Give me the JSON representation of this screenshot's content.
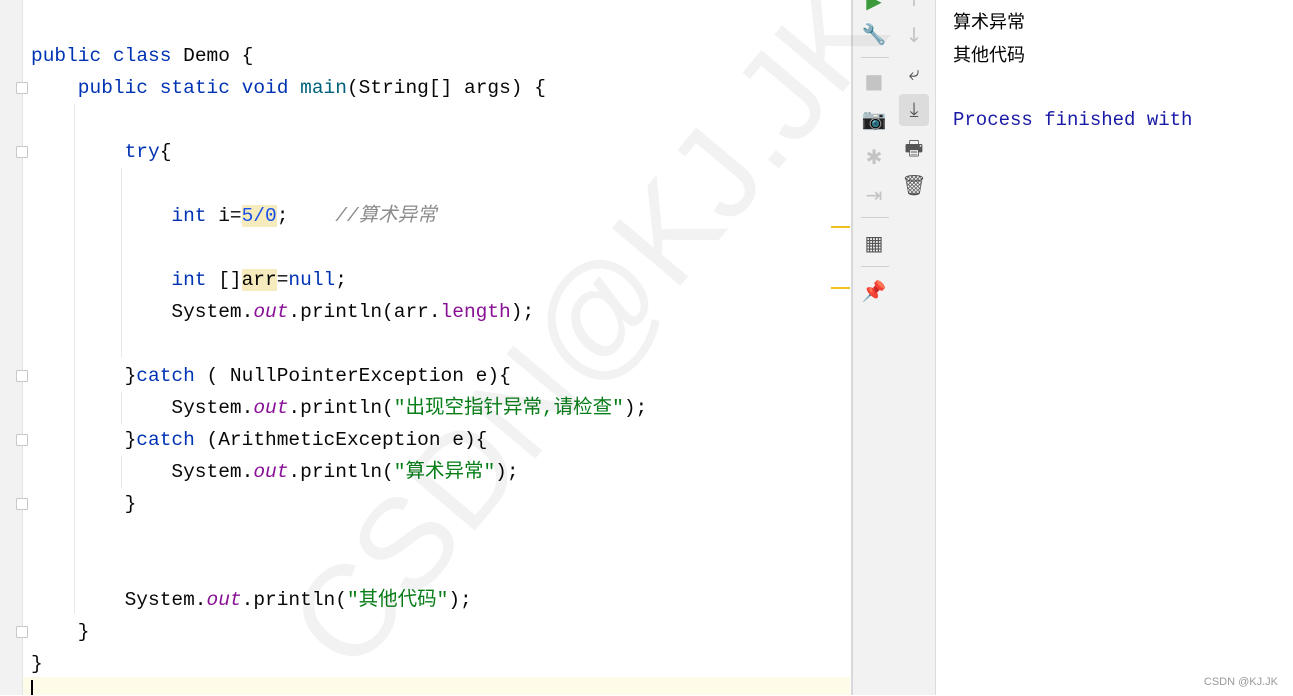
{
  "editor": {
    "lines": [
      {
        "row": 1,
        "indent": 0,
        "tokens": [
          [
            "public ",
            "kw"
          ],
          [
            "class ",
            "kw"
          ],
          [
            "Demo {",
            ""
          ]
        ]
      },
      {
        "row": 2,
        "indent": 1,
        "tokens": [
          [
            "public ",
            "kw"
          ],
          [
            "static ",
            "kw"
          ],
          [
            "void ",
            "kw"
          ],
          [
            "main",
            "fn"
          ],
          [
            "(String[] args) {",
            ""
          ]
        ]
      },
      {
        "row": 4,
        "indent": 2,
        "tokens": [
          [
            "try",
            "kw"
          ],
          [
            "{",
            ""
          ]
        ]
      },
      {
        "row": 6,
        "indent": 3,
        "tokens": [
          [
            "int ",
            "kw"
          ],
          [
            "i=",
            ""
          ],
          [
            "5/0",
            "num hl"
          ],
          [
            ";    ",
            ""
          ],
          [
            "//算术异常",
            "cm"
          ]
        ]
      },
      {
        "row": 8,
        "indent": 3,
        "tokens": [
          [
            "int ",
            "kw"
          ],
          [
            "[]",
            ""
          ],
          [
            "arr",
            "var hl"
          ],
          [
            "=",
            ""
          ],
          [
            "null",
            "kw"
          ],
          [
            ";",
            ""
          ]
        ]
      },
      {
        "row": 9,
        "indent": 3,
        "tokens": [
          [
            "System.",
            ""
          ],
          [
            "out",
            "fld"
          ],
          [
            ".println(arr.",
            ""
          ],
          [
            "length",
            "prop"
          ],
          [
            ");",
            ""
          ]
        ]
      },
      {
        "row": 11,
        "indent": 2,
        "tokens": [
          [
            "}",
            ""
          ],
          [
            "catch ",
            "kw"
          ],
          [
            "( NullPointerException e){",
            ""
          ]
        ]
      },
      {
        "row": 12,
        "indent": 3,
        "tokens": [
          [
            "System.",
            ""
          ],
          [
            "out",
            "fld"
          ],
          [
            ".println(",
            ""
          ],
          [
            "\"出现空指针异常,请检查\"",
            "st"
          ],
          [
            ");",
            ""
          ]
        ]
      },
      {
        "row": 13,
        "indent": 2,
        "tokens": [
          [
            "}",
            ""
          ],
          [
            "catch ",
            "kw"
          ],
          [
            "(ArithmeticException e){",
            ""
          ]
        ]
      },
      {
        "row": 14,
        "indent": 3,
        "tokens": [
          [
            "System.",
            ""
          ],
          [
            "out",
            "fld"
          ],
          [
            ".println(",
            ""
          ],
          [
            "\"算术异常\"",
            "st"
          ],
          [
            ");",
            ""
          ]
        ]
      },
      {
        "row": 15,
        "indent": 2,
        "tokens": [
          [
            "}",
            ""
          ]
        ]
      },
      {
        "row": 18,
        "indent": 2,
        "tokens": [
          [
            "System.",
            ""
          ],
          [
            "out",
            "fld"
          ],
          [
            ".println(",
            ""
          ],
          [
            "\"其他代码\"",
            "st"
          ],
          [
            ");",
            ""
          ]
        ]
      },
      {
        "row": 19,
        "indent": 1,
        "tokens": [
          [
            "}",
            ""
          ]
        ]
      },
      {
        "row": 20,
        "indent": 0,
        "tokens": [
          [
            "}",
            ""
          ]
        ]
      }
    ]
  },
  "toolbar_left": [
    "run-icon",
    "wrench-icon",
    "stop-icon",
    "camera-icon",
    "debug-icon",
    "login-icon",
    "layout-icon",
    "pin-icon"
  ],
  "toolbar_right": [
    "up-arrow-icon",
    "down-arrow-icon",
    "soft-wrap-icon",
    "scroll-to-end-icon",
    "print-icon",
    "trash-icon"
  ],
  "console": {
    "lines": [
      "算术异常",
      "其他代码",
      "",
      "Process finished with"
    ]
  },
  "watermark": "CSDN@KJ.JK",
  "credit": "CSDN @KJ.JK"
}
